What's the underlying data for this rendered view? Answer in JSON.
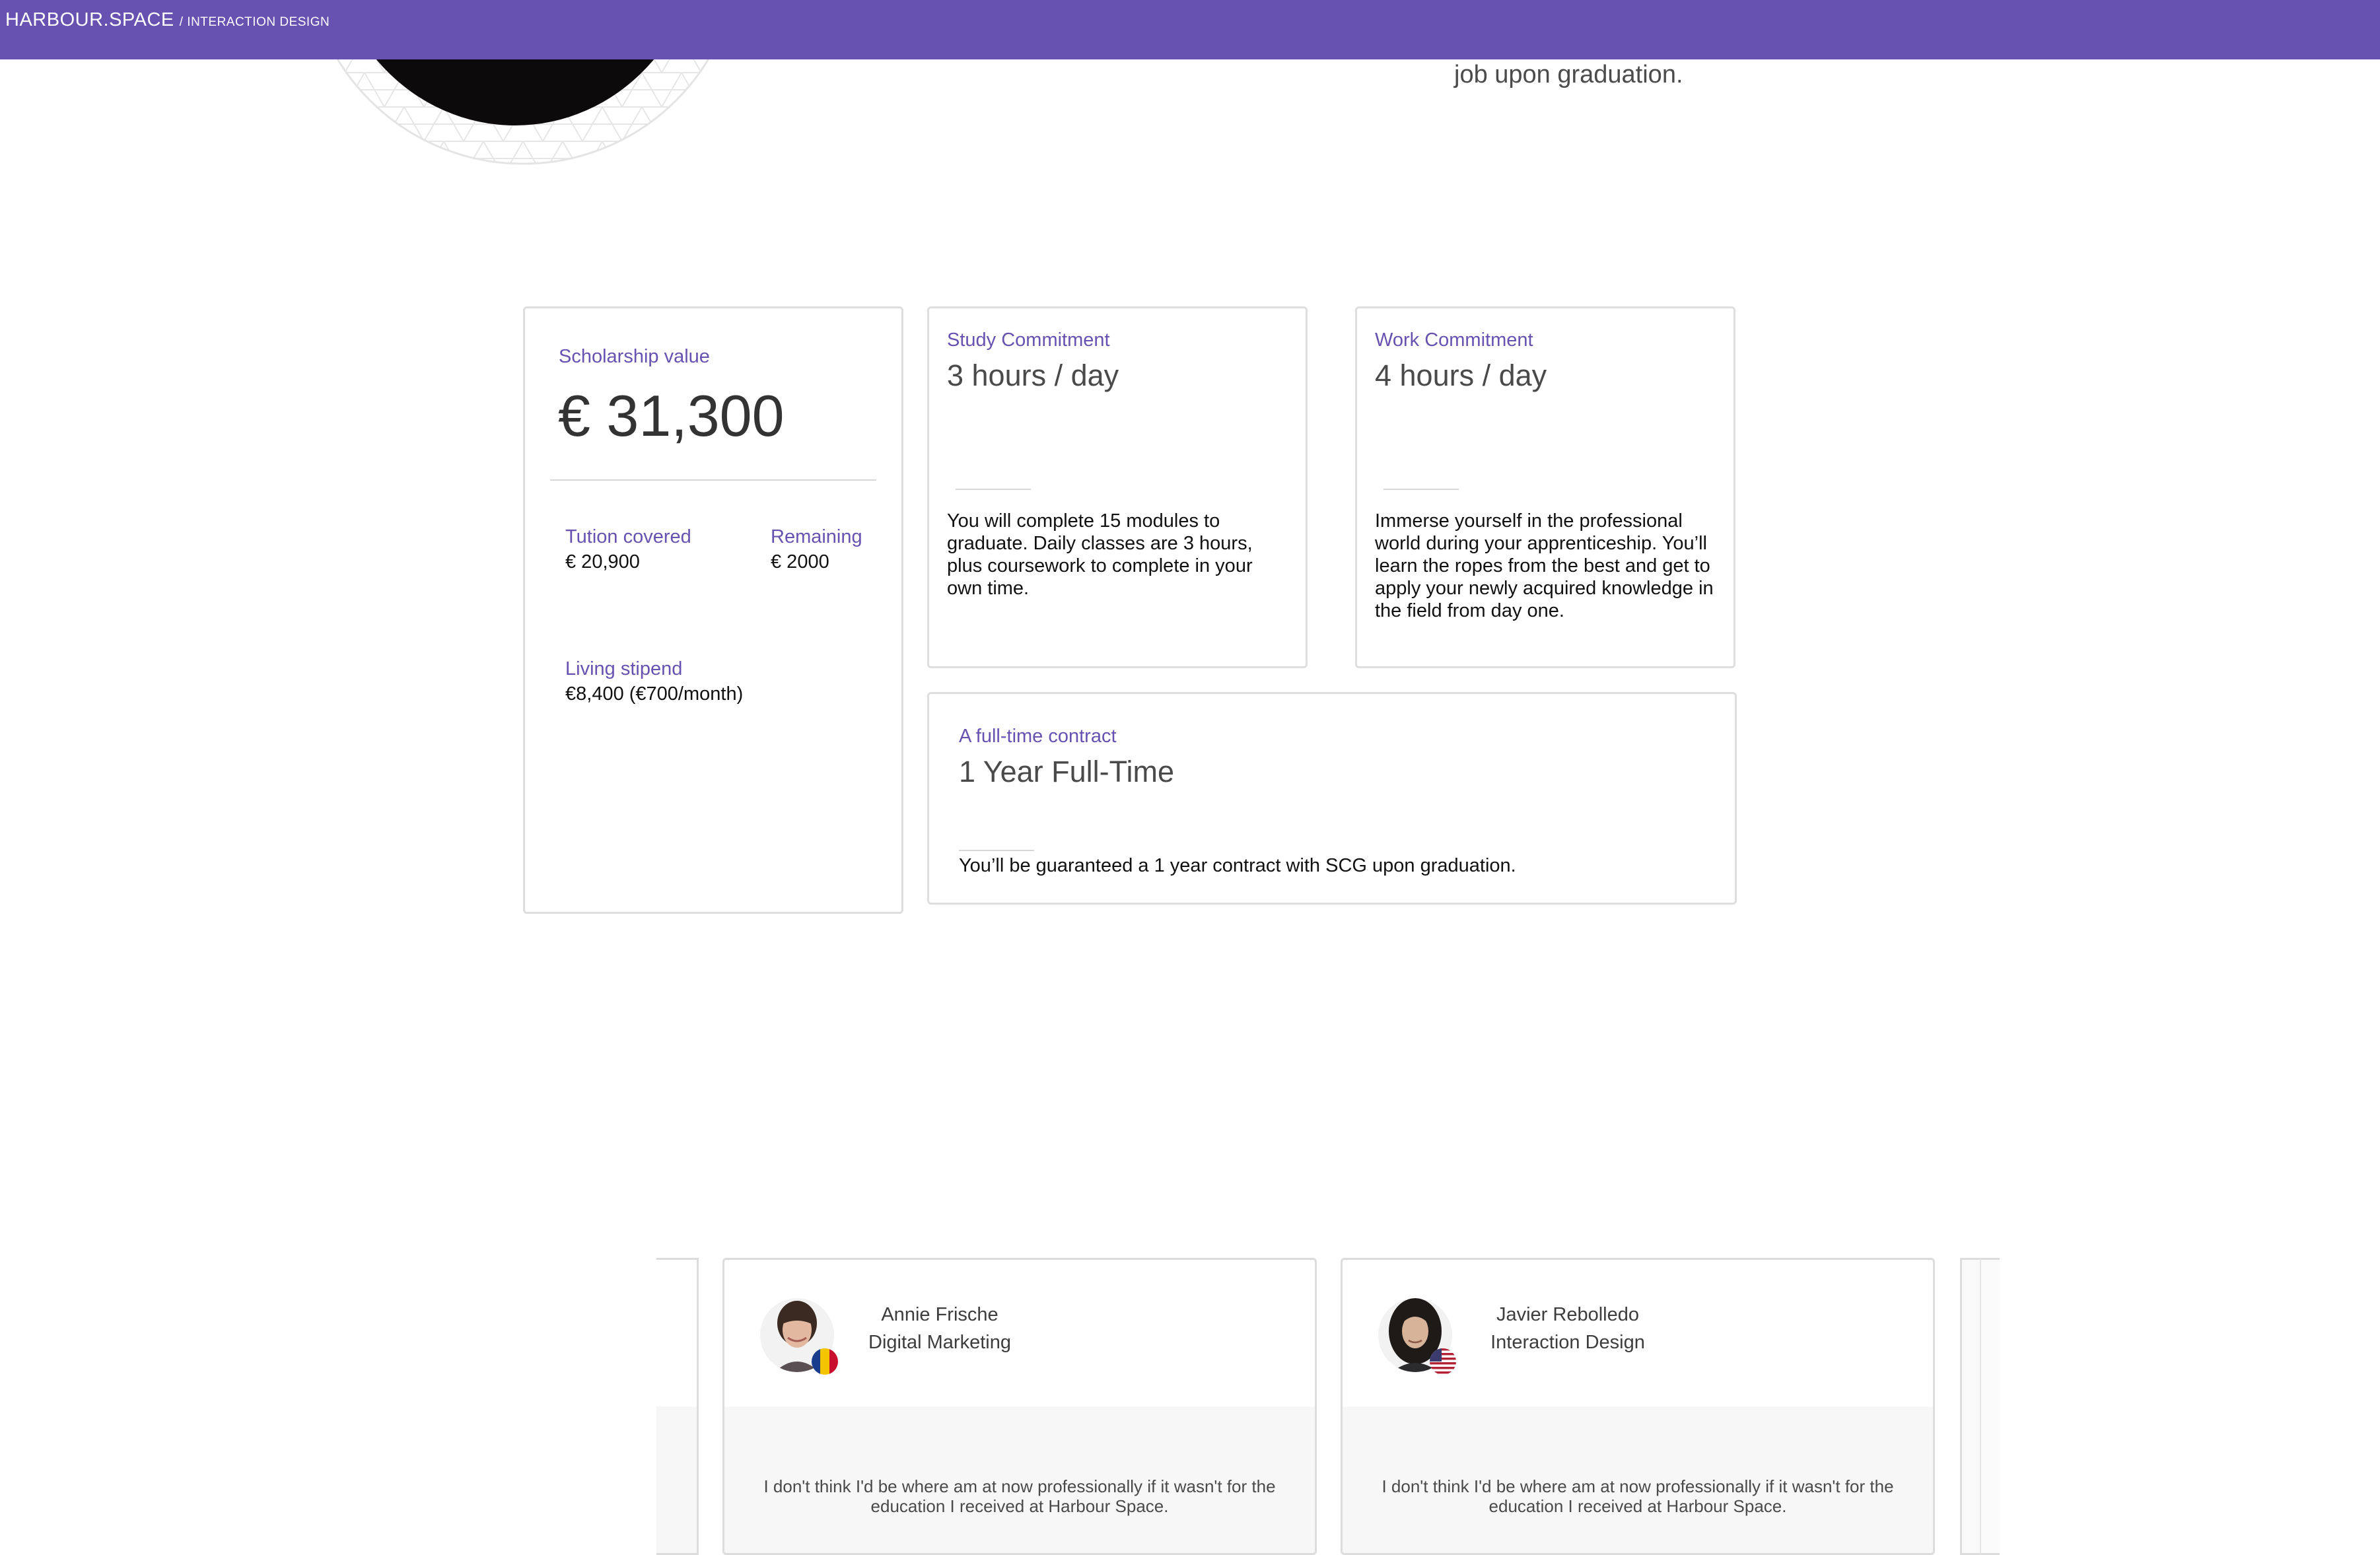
{
  "header": {
    "brand": "HARBOUR.SPACE",
    "section": "/ INTERACTION DESIGN"
  },
  "hero": {
    "text": "job upon graduation."
  },
  "scholarship": {
    "label": "Scholarship value",
    "value": "€ 31,300",
    "tuition_label": "Tution covered",
    "tuition_value": "€ 20,900",
    "remaining_label": "Remaining",
    "remaining_value": "€ 2000",
    "stipend_label": "Living stipend",
    "stipend_value": "€8,400 (€700/month)"
  },
  "study": {
    "label": "Study Commitment",
    "value": "3 hours / day",
    "description": "You will complete 15 modules to graduate. Daily classes are 3 hours, plus coursework to complete in your own time."
  },
  "work": {
    "label": "Work Commitment",
    "value": "4 hours / day",
    "description": "Immerse yourself in the professional world during your apprenticeship. You’ll learn the ropes from the best and get to apply your newly acquired knowledge in the field from day one."
  },
  "contract": {
    "label": "A full-time contract",
    "value": "1 Year Full-Time",
    "description": "You’ll be guaranteed a 1 year contract with SCG upon graduation."
  },
  "testimonials": [
    {
      "name": "Annie Frische",
      "program": "Digital Marketing",
      "quote": "I don't think I'd be where am at now professionally if it wasn't for the education I received at Harbour Space.",
      "avatar_icon": "student-photo-icon",
      "flag_icon": "romania-flag-icon"
    },
    {
      "name": "Javier Rebolledo",
      "program": "Interaction Design",
      "quote": "I don't think I'd be where am at now professionally if it wasn't for the education I received at Harbour Space.",
      "avatar_icon": "student-photo-icon",
      "flag_icon": "usa-flag-icon"
    }
  ],
  "colors": {
    "brand": "#6752b1",
    "card_border": "#dedede",
    "quote_bg": "#f7f7f7"
  }
}
